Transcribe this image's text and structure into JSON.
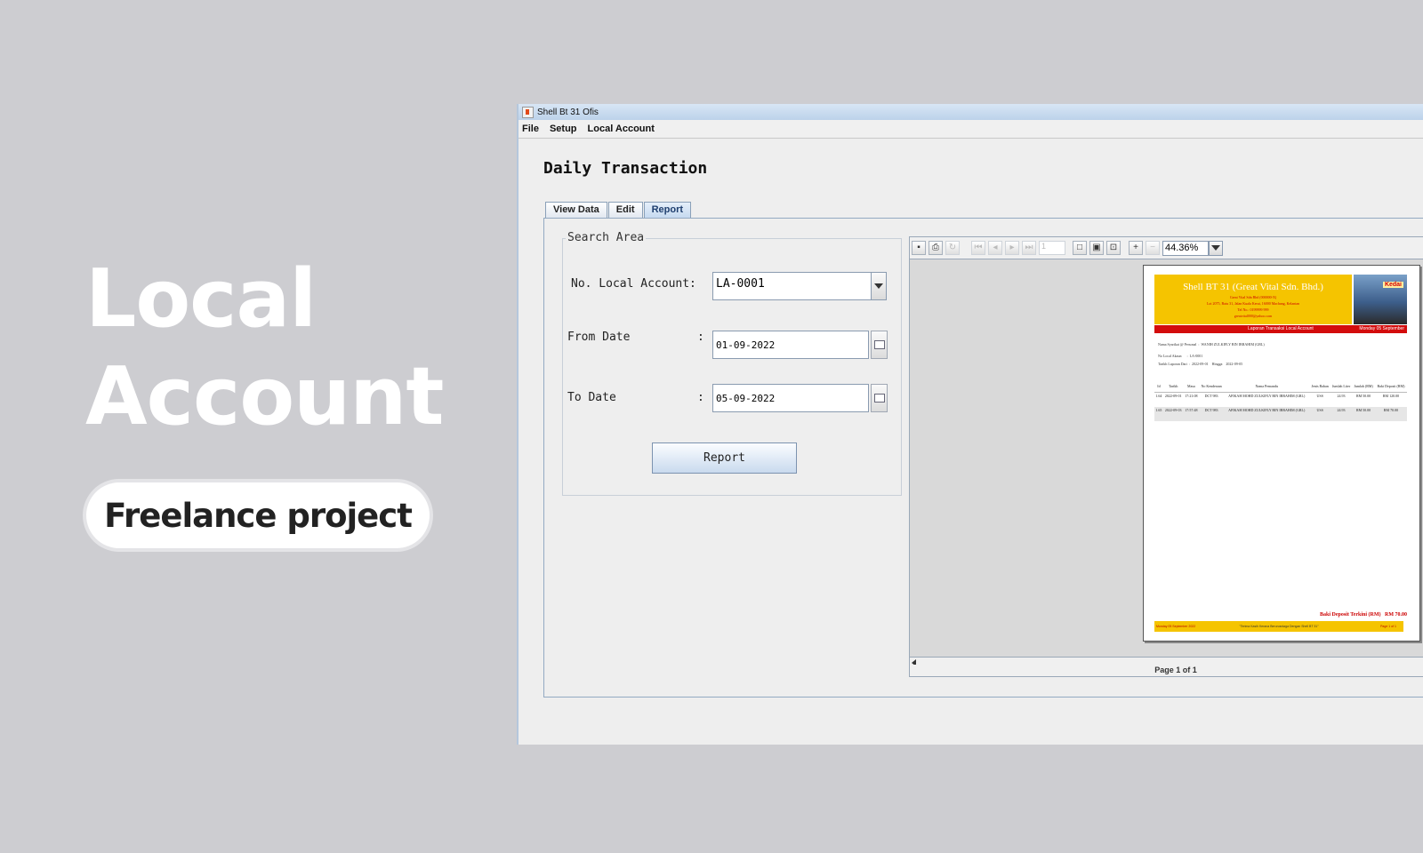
{
  "hero": {
    "title_line1": "Local",
    "title_line2": "Account",
    "tag": "Freelance project"
  },
  "window": {
    "title": "Shell Bt 31 Ofis",
    "menu": [
      "File",
      "Setup",
      "Local Account"
    ],
    "panel_title": "Daily Transaction",
    "tabs": [
      "View Data",
      "Edit",
      "Report"
    ],
    "active_tab": "Report"
  },
  "search": {
    "legend": "Search Area",
    "account_label": "No. Local Account:",
    "account_value": "LA-0001",
    "from_label": "From Date",
    "from_value": "01-09-2022",
    "to_label": "To Date",
    "to_value": "05-09-2022",
    "colon": ":",
    "report_button": "Report"
  },
  "viewer": {
    "page_input": "1",
    "zoom": "44.36%",
    "status": "Page 1 of 1",
    "icons": [
      "save-icon",
      "print-icon",
      "reload-icon",
      "first-page-icon",
      "previous-page-icon",
      "next-page-icon",
      "last-page-icon",
      "actual-size-icon",
      "fit-page-icon",
      "fit-width-icon",
      "zoom-in-icon",
      "zoom-out-icon"
    ]
  },
  "report": {
    "company": "Shell BT 31 (Great Vital Sdn. Bhd.)",
    "address_lines": [
      "Great Vital Sdn Bhd (000000-X)",
      "Lot 2075, Batu 31, Jalan Kuala Kerai, 16000 Machang, Kelantan",
      "Tel No.: 0199999 999",
      "greatvital000@yahoo.com"
    ],
    "photo_sign": "Kedai",
    "banner": "Laporan Transaksi Local Account",
    "banner_date": "Monday 05 September",
    "info": {
      "name_label": "Nama Syarikat @ Personal",
      "name_value": "WANIH ZULKIFLY BIN IBRAHIM (GRL)",
      "acc_label": "No Local Akaun",
      "acc_value": "LA-0001",
      "date_label": "Tarikh Laporan Dari",
      "date_from": "2022-09-01",
      "date_to_label": "Hingga",
      "date_to": "2022-09-05"
    },
    "columns": [
      "Id",
      "Tarikh",
      "Masa",
      "No Kenderaan",
      "Nama Pemandu",
      "Jenis Bahan",
      "Jumlah Liter",
      "Jumlah (RM)",
      "Baki Deposit (RM)"
    ],
    "rows": [
      [
        "1.64",
        "2022-09-01",
        "17:21:08",
        "DCT 983",
        "AFIKAH MOHD ZULKIFLY BIN IBRAHIM (GRL)",
        "USS",
        "24.93",
        "RM 50.00",
        "RM 120.00"
      ],
      [
        "1.65",
        "2022-09-03",
        "17:57:48",
        "DCT 983",
        "AFIKAH MOHD ZULKIFLY BIN IBRAHIM (GRL)",
        "USS",
        "24.93",
        "RM 50.00",
        "RM 70.00"
      ]
    ],
    "total_label": "Baki Deposit Terkini (RM)",
    "total_value": "RM 70.00",
    "footer_left": "Monday 05 September 2022",
    "footer_center": "\"Terima Kasih Kerana Berurusniaga Dengan Shell BT 31\"",
    "footer_right": "Page 1 of 1"
  }
}
